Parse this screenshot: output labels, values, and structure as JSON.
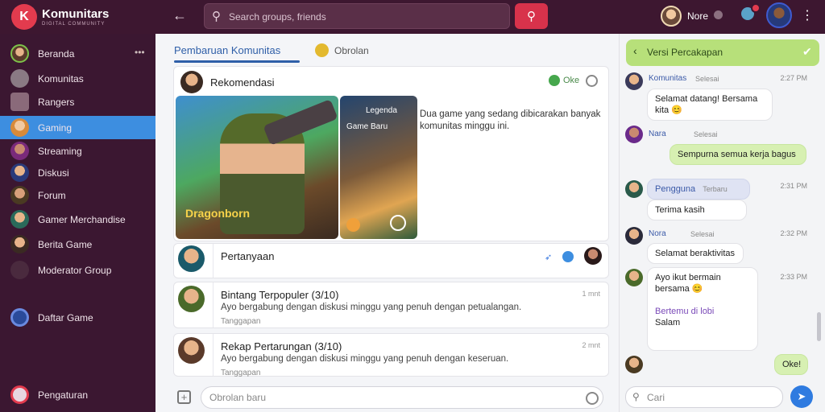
{
  "app": {
    "name": "Komunitars",
    "tagline": "DIGITAL COMMUNITY",
    "logo_letter": "K"
  },
  "header": {
    "search_placeholder": "Search groups, friends",
    "user_name": "Nore"
  },
  "sidebar": {
    "items": [
      {
        "label": "Beranda",
        "more": "•••"
      },
      {
        "label": "Komunitas"
      },
      {
        "label": "Rangers"
      },
      {
        "label": "Gaming",
        "active": true
      },
      {
        "label": "Streaming"
      },
      {
        "label": "Diskusi"
      },
      {
        "label": "Forum"
      },
      {
        "label": "Gamer Merchandise"
      },
      {
        "label": "Berita Game"
      },
      {
        "label": "Moderator Group"
      },
      {
        "label": "Daftar Game"
      },
      {
        "label": "Pengaturan"
      }
    ]
  },
  "main": {
    "tabs": {
      "active": "Pembaruan Komunitas",
      "other": "Obrolan"
    },
    "post": {
      "title": "Rekomendasi",
      "reaction_label": "Oke",
      "hero_caption": "Dragonborn",
      "side_caption1": "Legenda",
      "side_caption2": "Game Baru",
      "body": "Dua game yang sedang dibicarakan banyak komunitas minggu ini."
    },
    "feed": [
      {
        "title": "Pertanyaan",
        "text": "",
        "meta": "",
        "time": ""
      },
      {
        "title": "Bintang Terpopuler (3/10)",
        "text": "Ayo bergabung dengan diskusi minggu yang penuh dengan petualangan.",
        "meta": "Tanggapan",
        "time": "1 mnt"
      },
      {
        "title": "Rekap Pertarungan (3/10)",
        "text": "Ayo bergabung dengan diskusi minggu yang penuh dengan keseruan.",
        "meta": "Tanggapan",
        "time": "2 mnt"
      }
    ],
    "composer_placeholder": "Obrolan baru"
  },
  "chat": {
    "header": "Versi Percakapan",
    "messages": [
      {
        "name": "Komunitas",
        "sub": "Selesai",
        "time": "2:27 PM",
        "text": "Selamat datang! Bersama kita 😊"
      },
      {
        "name": "Nara",
        "sub": "Selesai",
        "text": "Sempurna semua kerja bagus"
      },
      {
        "name": "Pengguna",
        "sub": "Terbaru",
        "time": "2:31 PM",
        "text": "Terima kasih"
      },
      {
        "name": "Nora",
        "sub": "Selesai",
        "time": "2:32 PM",
        "text": "Selamat beraktivitas"
      },
      {
        "name": "",
        "sub": "",
        "time": "2:33 PM",
        "text": "Ayo ikut bermain bersama 😊",
        "extra1": "Bertemu di lobi",
        "extra2": "Salam"
      },
      {
        "name": "",
        "sub": "",
        "time": "",
        "text": "Oke!"
      }
    ],
    "search_placeholder": "Cari"
  }
}
